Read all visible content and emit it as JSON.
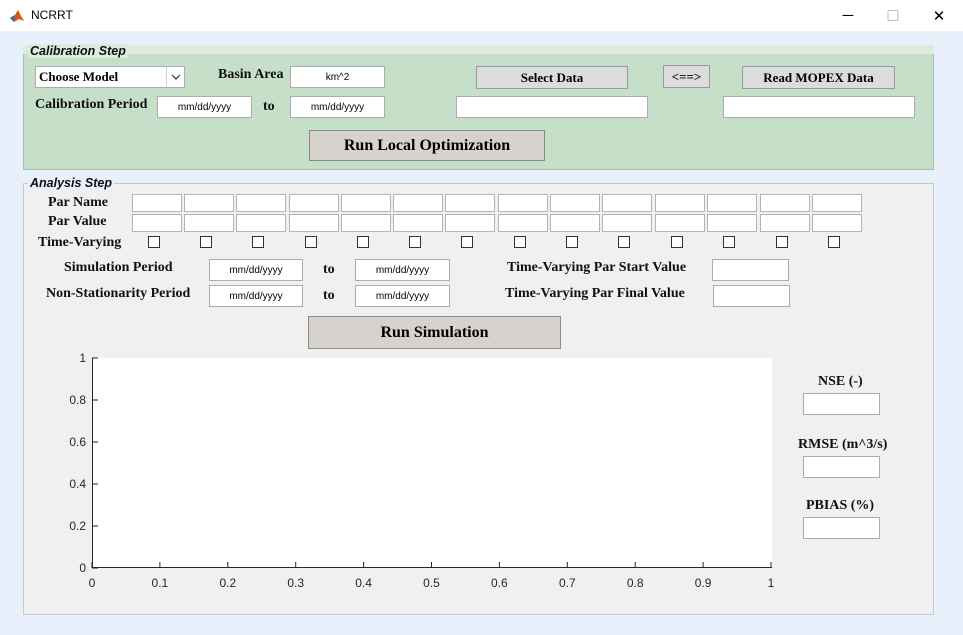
{
  "window": {
    "title": "NCRRT",
    "controls": [
      "minimize",
      "maximize",
      "close"
    ],
    "control_glyphs": {
      "minimize": "─",
      "maximize": "☐",
      "close": "✕"
    },
    "app_icon": "matlab-icon"
  },
  "calibration": {
    "panel_title": "Calibration Step",
    "model_select": {
      "value": "Choose Model"
    },
    "basin_area": {
      "label": "Basin Area",
      "value": "km^2"
    },
    "select_data_button": "Select Data",
    "swap_button": "<==>",
    "read_mopex_button": "Read MOPEX Data",
    "calibration_period": {
      "label": "Calibration Period",
      "start": "mm/dd/yyyy",
      "to": "to",
      "end": "mm/dd/yyyy"
    },
    "select_data_path": "",
    "mopex_path": "",
    "run_local_button": "Run Local Optimization"
  },
  "analysis": {
    "panel_title": "Analysis Step",
    "par_name_label": "Par Name",
    "par_value_label": "Par Value",
    "time_varying_label": "Time-Varying",
    "param_count": 14,
    "par_names": [
      "",
      "",
      "",
      "",
      "",
      "",
      "",
      "",
      "",
      "",
      "",
      "",
      "",
      ""
    ],
    "par_values": [
      "",
      "",
      "",
      "",
      "",
      "",
      "",
      "",
      "",
      "",
      "",
      "",
      "",
      ""
    ],
    "time_varying_checked": [
      false,
      false,
      false,
      false,
      false,
      false,
      false,
      false,
      false,
      false,
      false,
      false,
      false,
      false
    ],
    "simulation_period": {
      "label": "Simulation Period",
      "start": "mm/dd/yyyy",
      "to": "to",
      "end": "mm/dd/yyyy"
    },
    "nonstationarity_period": {
      "label": "Non-Stationarity Period",
      "start": "mm/dd/yyyy",
      "to": "to",
      "end": "mm/dd/yyyy"
    },
    "tv_start": {
      "label": "Time-Varying Par Start Value",
      "value": ""
    },
    "tv_final": {
      "label": "Time-Varying Par Final Value",
      "value": ""
    },
    "run_simulation_button": "Run Simulation",
    "metrics": {
      "nse": {
        "label": "NSE (-)",
        "value": ""
      },
      "rmse": {
        "label": "RMSE (m^3/s)",
        "value": ""
      },
      "pbias": {
        "label": "PBIAS (%)",
        "value": ""
      }
    }
  },
  "chart_data": {
    "type": "line",
    "title": "",
    "xlabel": "",
    "ylabel": "",
    "xlim": [
      0,
      1
    ],
    "ylim": [
      0,
      1
    ],
    "x_ticks": [
      "0",
      "0.1",
      "0.2",
      "0.3",
      "0.4",
      "0.5",
      "0.6",
      "0.7",
      "0.8",
      "0.9",
      "1"
    ],
    "y_ticks": [
      "0",
      "0.2",
      "0.4",
      "0.6",
      "0.8",
      "1"
    ],
    "series": [],
    "grid": false
  }
}
